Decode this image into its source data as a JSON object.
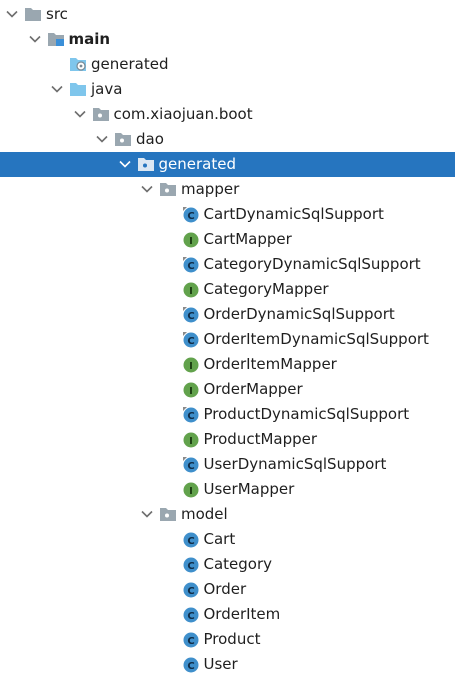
{
  "tree": {
    "items": [
      {
        "label": "src",
        "icon": "folder-icon",
        "expanded": true,
        "depth": 0
      },
      {
        "label": "main",
        "icon": "source-folder-icon",
        "expanded": true,
        "depth": 1,
        "bold": true
      },
      {
        "label": "generated",
        "icon": "generated-folder-icon",
        "depth": 2
      },
      {
        "label": "java",
        "icon": "source-root-folder-icon",
        "expanded": true,
        "depth": 2
      },
      {
        "label": "com.xiaojuan.boot",
        "icon": "package-icon",
        "expanded": true,
        "depth": 3
      },
      {
        "label": "dao",
        "icon": "package-icon",
        "expanded": true,
        "depth": 4
      },
      {
        "label": "generated",
        "icon": "package-icon",
        "expanded": true,
        "depth": 5,
        "selected": true
      },
      {
        "label": "mapper",
        "icon": "package-icon",
        "expanded": true,
        "depth": 6
      },
      {
        "label": "CartDynamicSqlSupport",
        "icon": "final-class-icon",
        "depth": 7
      },
      {
        "label": "CartMapper",
        "icon": "interface-icon",
        "depth": 7
      },
      {
        "label": "CategoryDynamicSqlSupport",
        "icon": "final-class-icon",
        "depth": 7
      },
      {
        "label": "CategoryMapper",
        "icon": "interface-icon",
        "depth": 7
      },
      {
        "label": "OrderDynamicSqlSupport",
        "icon": "final-class-icon",
        "depth": 7
      },
      {
        "label": "OrderItemDynamicSqlSupport",
        "icon": "final-class-icon",
        "depth": 7
      },
      {
        "label": "OrderItemMapper",
        "icon": "interface-icon",
        "depth": 7
      },
      {
        "label": "OrderMapper",
        "icon": "interface-icon",
        "depth": 7
      },
      {
        "label": "ProductDynamicSqlSupport",
        "icon": "final-class-icon",
        "depth": 7
      },
      {
        "label": "ProductMapper",
        "icon": "interface-icon",
        "depth": 7
      },
      {
        "label": "UserDynamicSqlSupport",
        "icon": "final-class-icon",
        "depth": 7
      },
      {
        "label": "UserMapper",
        "icon": "interface-icon",
        "depth": 7
      },
      {
        "label": "model",
        "icon": "package-icon",
        "expanded": true,
        "depth": 6
      },
      {
        "label": "Cart",
        "icon": "class-icon",
        "depth": 7
      },
      {
        "label": "Category",
        "icon": "class-icon",
        "depth": 7
      },
      {
        "label": "Order",
        "icon": "class-icon",
        "depth": 7
      },
      {
        "label": "OrderItem",
        "icon": "class-icon",
        "depth": 7
      },
      {
        "label": "Product",
        "icon": "class-icon",
        "depth": 7
      },
      {
        "label": "User",
        "icon": "class-icon",
        "depth": 7
      }
    ]
  },
  "colors": {
    "selection": "#2675bf",
    "class": "#3f8fcb",
    "interface": "#62a24c",
    "folder": "#9aa7b0",
    "source_root": "#7fc6ec"
  }
}
